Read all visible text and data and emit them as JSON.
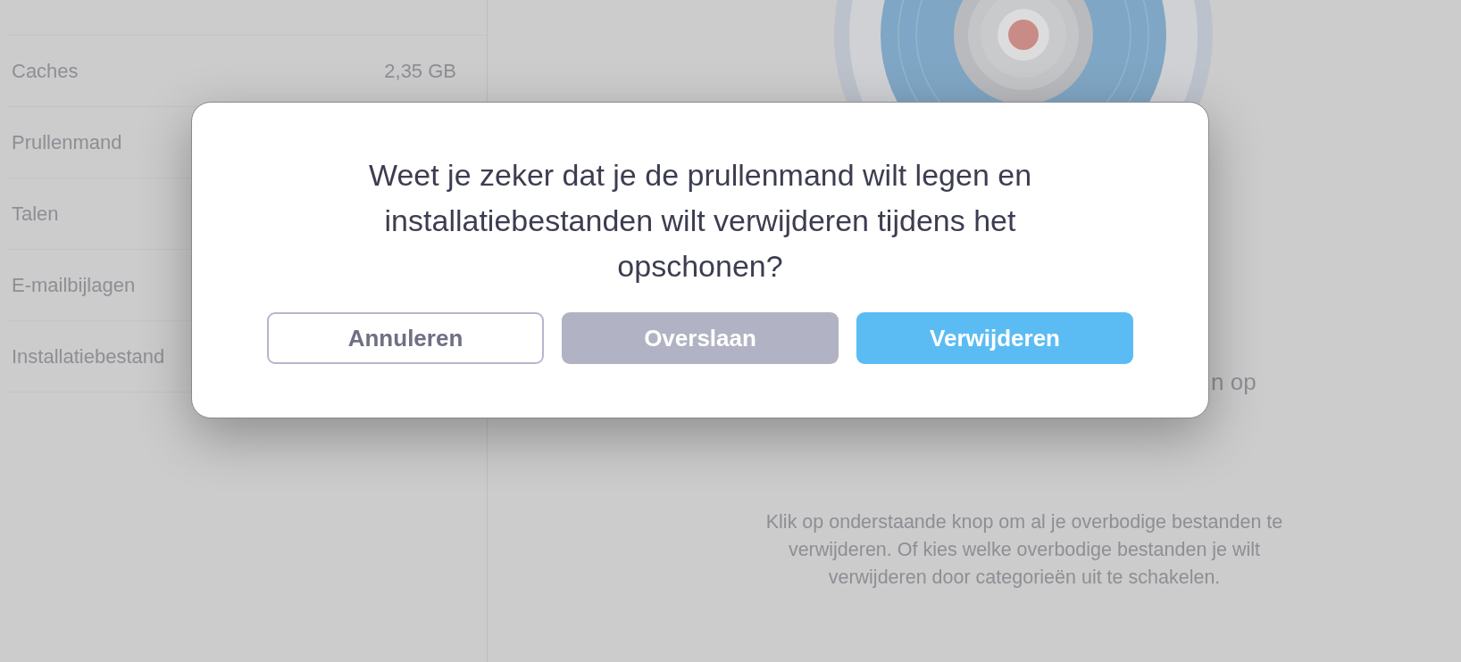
{
  "sidebar": {
    "items": [
      {
        "label": "Caches",
        "value": "2,35 GB"
      },
      {
        "label": "Prullenmand"
      },
      {
        "label": "Talen"
      },
      {
        "label": "E-mailbijlagen"
      },
      {
        "label": "Installatiebestand"
      }
    ]
  },
  "main": {
    "partial_line": "n op",
    "description": "Klik op onderstaande knop om al je overbodige bestanden te verwijderen. Of kies welke overbodige bestanden je wilt verwijderen door categorieën uit te schakelen."
  },
  "dialog": {
    "message": "Weet je zeker dat je de prullenmand wilt legen en installatiebestanden wilt verwijderen tijdens het opschonen?",
    "buttons": [
      {
        "label": "Annuleren",
        "kind": "outline"
      },
      {
        "label": "Overslaan",
        "kind": "secondary"
      },
      {
        "label": "Verwijderen",
        "kind": "primary"
      }
    ]
  }
}
